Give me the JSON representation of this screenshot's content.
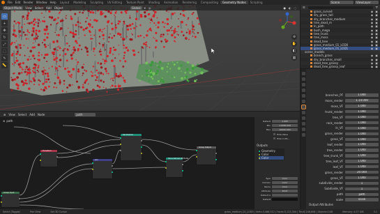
{
  "topbar": {
    "menus": [
      "File",
      "Edit",
      "Render",
      "Window",
      "Help"
    ],
    "workspaces": [
      "Layout",
      "Modeling",
      "Sculpting",
      "UV Editing",
      "Texture Paint",
      "Shading",
      "Animation",
      "Rendering",
      "Compositing",
      "Geometry Nodes",
      "Scripting"
    ],
    "active_workspace": "Geometry Nodes",
    "scene": "Scene",
    "view_layer": "ViewLayer"
  },
  "viewport": {
    "mode": "Object Mode",
    "menus": [
      "View",
      "Select",
      "Add",
      "Object"
    ],
    "transform": "Global"
  },
  "outliner": {
    "items": [
      "grass_curved",
      "dry_grass_tall",
      "dry_branches_medium",
      "tree_dead_m",
      "ln_path",
      "bush_mega",
      "tree_trunk",
      "tree_moss",
      "dead_tree",
      "grass_medium_01_LOD0",
      "grass_medium_01_LOD1"
    ],
    "selected_index": 10,
    "collection2": "scene_models",
    "items2": [
      "branch_grass",
      "dry_branches_small",
      "dead_tree_grassy",
      "dead_tree_grassy_leaf"
    ]
  },
  "props": {
    "rows": [
      {
        "label": "branches_PF",
        "value": "1.000"
      },
      {
        "label": "moss_render",
        "value": "1.14.000"
      },
      {
        "label": "moss_VF",
        "value": "1.000"
      },
      {
        "label": "trunk_render",
        "value": "1.000"
      },
      {
        "label": "tree_VF",
        "value": "1.000"
      },
      {
        "label": "rock_render",
        "value": "1.000"
      },
      {
        "label": "ln_VF",
        "value": "1.000"
      },
      {
        "label": "grass_render",
        "value": "1.000"
      },
      {
        "label": "grass_VF",
        "value": "1.000"
      },
      {
        "label": "leaf_render",
        "value": "1.000"
      },
      {
        "label": "tree_render",
        "value": "1.000"
      },
      {
        "label": "tree_trunk_VF",
        "value": "1.000"
      },
      {
        "label": "tree_leaf_VF",
        "value": "1.000"
      },
      {
        "label": "leaf_VF",
        "value": "1.000"
      },
      {
        "label": "grass_render",
        "value": "20.000"
      },
      {
        "label": "grass_VF",
        "value": "1.000"
      },
      {
        "label": "subdivide_render",
        "value": "1"
      },
      {
        "label": "Subdivide_VF",
        "value": "1"
      },
      {
        "label": "path",
        "value": "path"
      },
      {
        "label": "scale",
        "value": "scale"
      }
    ],
    "footer": "Output Attributes"
  },
  "node_editor": {
    "menus": [
      "View",
      "Select",
      "Add",
      "Node"
    ],
    "tree_name": "path",
    "breadcrumb": "path",
    "nodes": [
      "Group Input",
      "Set Position",
      "Store Named Attribute",
      "Group Output",
      "Transform",
      "Join"
    ],
    "panel": {
      "default_label": "Default",
      "default_value": "1.000",
      "min_label": "Min",
      "min_value": "-10000.000",
      "max_label": "Max",
      "max_value": "10000.000",
      "hide_value": "Hide Value",
      "hide_in_mod": "Hide in Mo...",
      "outputs_title": "Outputs",
      "outputs": [
        "Geometry",
        "Color",
        "Color"
      ],
      "type_label": "Type",
      "type_value": "Color",
      "domain_label": "Domain",
      "domain_value": "Color",
      "name_label": "Name",
      "name_value": "Color",
      "attr_label": "Attribute",
      "attr_value": "Point",
      "default_a_label": "Default A",
      "default_a_value": "",
      "default_label2": "Default",
      "default_value2": ""
    }
  },
  "status": {
    "items": [
      "Select (Toggle)",
      "Pan View",
      "Set 3D Cursor",
      "grass_medium_01_LOD0 | Verts:3,466,512 | Faces:3,123,304 | Tris:6,246,608 | Objects:1/48",
      "Memory: 4.07 GiB",
      "3.1"
    ]
  },
  "colors": {
    "accent": "#e87d0d",
    "selection": "#4772b3",
    "flower_red": "#d0242a",
    "moss_green": "#3a9a3a"
  }
}
